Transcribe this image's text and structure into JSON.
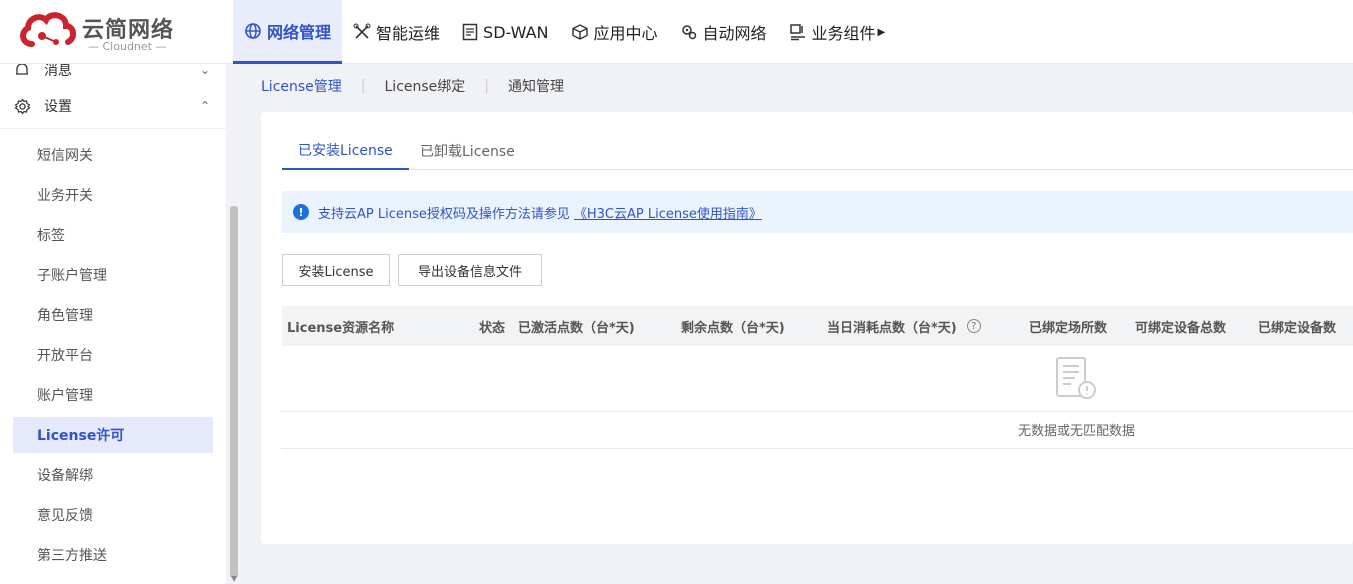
{
  "brand": {
    "name": "云简网络",
    "sub": "Cloudnet"
  },
  "nav": [
    {
      "label": "网络管理",
      "icon": "globe-icon"
    },
    {
      "label": "智能运维",
      "icon": "tools-icon"
    },
    {
      "label": "SD-WAN",
      "icon": "sdwan-icon"
    },
    {
      "label": "应用中心",
      "icon": "cube-icon"
    },
    {
      "label": "自动网络",
      "icon": "gears-icon"
    },
    {
      "label": "业务组件",
      "icon": "components-icon"
    }
  ],
  "sidebar": {
    "partial_group": "消息",
    "group": "设置",
    "items": [
      {
        "label": "短信网关"
      },
      {
        "label": "业务开关"
      },
      {
        "label": "标签"
      },
      {
        "label": "子账户管理"
      },
      {
        "label": "角色管理"
      },
      {
        "label": "开放平台"
      },
      {
        "label": "账户管理"
      },
      {
        "label": "License许可"
      },
      {
        "label": "设备解绑"
      },
      {
        "label": "意见反馈"
      },
      {
        "label": "第三方推送"
      }
    ]
  },
  "breadcrumbs": [
    "License管理",
    "License绑定",
    "通知管理"
  ],
  "tabs": [
    "已安装License",
    "已卸载License"
  ],
  "notice": {
    "text": "支持云AP License授权码及操作方法请参见",
    "link": "《H3C云AP License使用指南》"
  },
  "buttons": {
    "install": "安装License",
    "export": "导出设备信息文件"
  },
  "table": {
    "columns": [
      "License资源名称",
      "状态",
      "已激活点数（台*天)",
      "剩余点数（台*天)",
      "当日消耗点数（台*天)",
      "已绑定场所数",
      "可绑定设备总数",
      "已绑定设备数"
    ],
    "empty": "无数据或无匹配数据"
  },
  "colors": {
    "accent": "#2f54c8",
    "brand_red": "#c8262c"
  }
}
